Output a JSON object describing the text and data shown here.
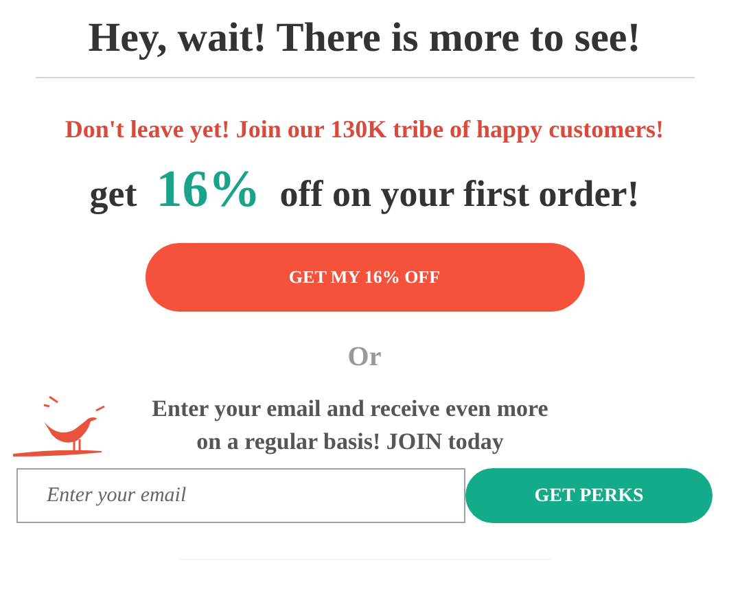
{
  "title": "Hey, wait! There is more to see!",
  "tagline": "Don't leave yet! Join our 130K tribe of happy customers!",
  "offer": {
    "prefix": "get",
    "discount": "16%",
    "suffix": "off on your first order!"
  },
  "offer_button": "GET MY 16% OFF",
  "separator": "Or",
  "signup": {
    "text": "Enter your email and receive even more on a regular basis! JOIN today",
    "email_placeholder": "Enter your email",
    "button": "GET PERKS"
  }
}
